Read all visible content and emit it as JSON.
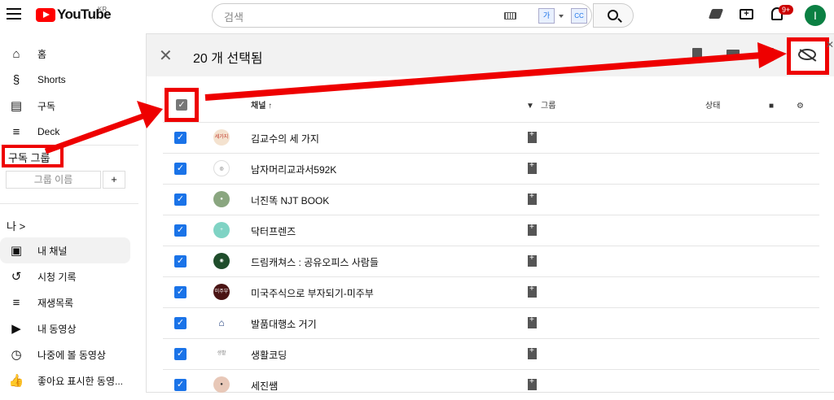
{
  "header": {
    "logo_text": "YouTube",
    "region": "KR",
    "search_placeholder": "검색",
    "lang_icon_text": "가",
    "cc_icon_text": "CC",
    "notification_count": "9+",
    "avatar_initial": "I"
  },
  "sidebar": {
    "nav": [
      {
        "label": "홈",
        "icon": "home-icon"
      },
      {
        "label": "Shorts",
        "icon": "shorts-icon"
      },
      {
        "label": "구독",
        "icon": "subscriptions-icon"
      },
      {
        "label": "Deck",
        "icon": "deck-icon"
      }
    ],
    "subscription_group_label": "구독 그룹",
    "group_name_placeholder": "그룹 이름",
    "group_add_label": "+",
    "me_label": "나  >",
    "me_items": [
      {
        "label": "내 채널",
        "icon": "channel-icon",
        "active": true
      },
      {
        "label": "시청 기록",
        "icon": "history-icon"
      },
      {
        "label": "재생목록",
        "icon": "playlist-icon"
      },
      {
        "label": "내 동영상",
        "icon": "video-icon"
      },
      {
        "label": "나중에 볼 동영상",
        "icon": "watch-later-icon"
      },
      {
        "label": "좋아요 표시한 동영...",
        "icon": "like-icon"
      }
    ]
  },
  "panel": {
    "close_label": "✕",
    "selection_title": "20 개 선택됨",
    "columns": {
      "channel": "채널 ↑",
      "group": "그룹",
      "status": "상태"
    },
    "rows": [
      {
        "name": "김교수의 세 가지",
        "avatar_text": "세가지",
        "avatar_color": "#f4e2cf",
        "avatar_fg": "#c0392b"
      },
      {
        "name": "남자머리교과서592K",
        "avatar_text": "◎",
        "avatar_color": "#ffffff",
        "avatar_fg": "#555555"
      },
      {
        "name": "너진똑 NJT BOOK",
        "avatar_text": "●",
        "avatar_color": "#8aa680",
        "avatar_fg": "#ffffff"
      },
      {
        "name": "닥터프렌즈",
        "avatar_text": "+",
        "avatar_color": "#7fd3c4",
        "avatar_fg": "#ffffff"
      },
      {
        "name": "드림캐쳐스 : 공유오피스 사람들",
        "avatar_text": "◉",
        "avatar_color": "#1f4d2b",
        "avatar_fg": "#ffffff"
      },
      {
        "name": "미국주식으로 부자되기-미주부",
        "avatar_text": "미주부",
        "avatar_color": "#4a1414",
        "avatar_fg": "#ffffff"
      },
      {
        "name": "발품대행소 거기",
        "avatar_text": "⌂",
        "avatar_color": "#ffffff",
        "avatar_fg": "#1a3a7a"
      },
      {
        "name": "생활코딩",
        "avatar_text": "생활",
        "avatar_color": "#ffffff",
        "avatar_fg": "#888888"
      },
      {
        "name": "세진쌤",
        "avatar_text": "●",
        "avatar_color": "#e8c8b8",
        "avatar_fg": "#333333"
      }
    ]
  }
}
